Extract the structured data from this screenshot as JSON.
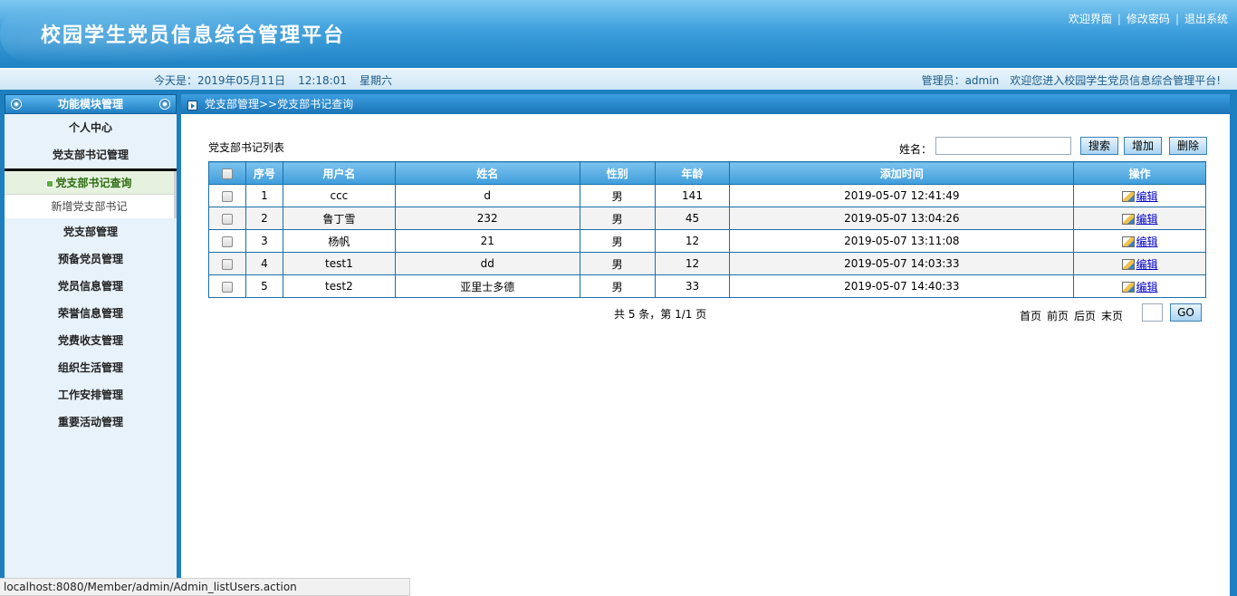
{
  "header": {
    "title": "校园学生党员信息综合管理平台",
    "links": [
      "欢迎界面",
      "修改密码",
      "退出系统"
    ],
    "sep": "|"
  },
  "strip": {
    "today_label": "今天是：2019年05月11日",
    "time": "12:18:01",
    "weekday": "星期六",
    "admin_label": "管理员：admin",
    "welcome": "欢迎您进入校园学生党员信息综合管理平台!"
  },
  "sidebar": {
    "header": "功能模块管理",
    "items_top": [
      "个人中心",
      "党支部书记管理"
    ],
    "submenu": {
      "active": "党支部书记查询",
      "other": "新增党支部书记"
    },
    "items_bottom": [
      "党支部管理",
      "预备党员管理",
      "党员信息管理",
      "荣誉信息管理",
      "党费收支管理",
      "组织生活管理",
      "工作安排管理",
      "重要活动管理"
    ]
  },
  "main": {
    "breadcrumb": "党支部管理>>党支部书记查询",
    "list_title": "党支部书记列表",
    "search_label": "姓名：",
    "search_value": "",
    "buttons": {
      "search": "搜索",
      "add": "增加",
      "delete": "删除",
      "go": "GO"
    },
    "table": {
      "columns": [
        "序号",
        "用户名",
        "姓名",
        "性别",
        "年龄",
        "添加时间",
        "操作"
      ],
      "rows": [
        {
          "no": "1",
          "username": "ccc",
          "name": "d",
          "gender": "男",
          "age": "141",
          "time": "2019-05-07 12:41:49"
        },
        {
          "no": "2",
          "username": "鲁丁雪",
          "name": "232",
          "gender": "男",
          "age": "45",
          "time": "2019-05-07 13:04:26"
        },
        {
          "no": "3",
          "username": "杨帆",
          "name": "21",
          "gender": "男",
          "age": "12",
          "time": "2019-05-07 13:11:08"
        },
        {
          "no": "4",
          "username": "test1",
          "name": "dd",
          "gender": "男",
          "age": "12",
          "time": "2019-05-07 14:03:33"
        },
        {
          "no": "5",
          "username": "test2",
          "name": "亚里士多德",
          "gender": "男",
          "age": "33",
          "time": "2019-05-07 14:40:33"
        }
      ],
      "edit_label": "编辑"
    },
    "summary": "共 5 条，第 1/1 页",
    "pager": [
      "首页",
      "前页",
      "后页",
      "末页"
    ],
    "page_value": ""
  },
  "statusbar": "localhost:8080/Member/admin/Admin_listUsers.action"
}
